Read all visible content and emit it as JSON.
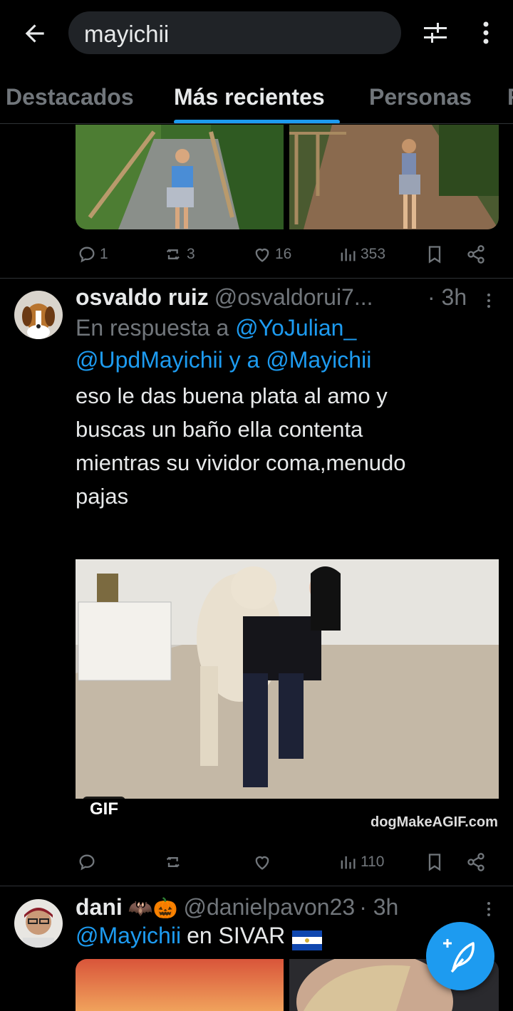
{
  "header": {
    "search_value": "mayichii",
    "tabs": [
      {
        "label": "Destacados"
      },
      {
        "label": "Más recientes"
      },
      {
        "label": "Personas"
      },
      {
        "label": "F"
      }
    ],
    "active_tab": "Más recientes"
  },
  "tweets": [
    {
      "actions": {
        "replies": "1",
        "retweets": "3",
        "likes": "16",
        "views": "353"
      }
    },
    {
      "name": "osvaldo ruiz",
      "handle": "@osvaldorui7...",
      "time": "· 3h",
      "reply_prefix": "En respuesta a",
      "reply_user1": "@YoJulian_",
      "reply_user2": "@UpdMayichii",
      "reply_and": "y a",
      "reply_user3": "@Mayichii",
      "text_lines": [
        "eso le das buena plata al amo y",
        "buscas un baño ella contenta",
        "mientras su vividor coma,menudo",
        "pajas"
      ],
      "media_badge": "GIF",
      "media_credit": "dogMakeAGIF.com",
      "actions": {
        "replies": "",
        "retweets": "",
        "likes": "",
        "views": "110"
      }
    },
    {
      "name": "dani",
      "emoji": "🦇🎃",
      "handle": "@danielpavon23",
      "time": "· 3h",
      "mention": "@Mayichii",
      "text": "en SIVAR"
    }
  ],
  "colors": {
    "accent": "#1d9bf0",
    "background": "#000000",
    "muted": "#71767b",
    "divider": "#2f3336"
  }
}
